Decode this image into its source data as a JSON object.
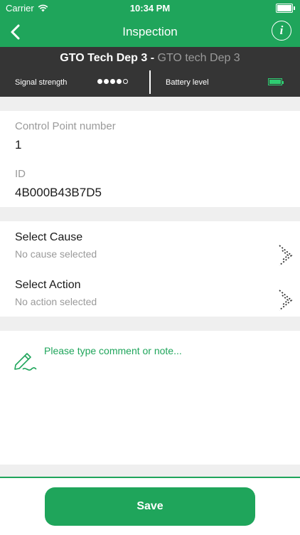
{
  "status_bar": {
    "carrier": "Carrier",
    "time": "10:34 PM"
  },
  "nav": {
    "title": "Inspection",
    "back_icon": "chevron-left-icon",
    "info_icon": "info-icon"
  },
  "device": {
    "name": "GTO Tech Dep 3",
    "separator": " - ",
    "subname": "GTO tech Dep 3",
    "signal_label": "Signal strength",
    "signal_level": 4,
    "signal_max": 5,
    "battery_label": "Battery level",
    "battery_level": 1.0,
    "battery_color": "#2ecc71"
  },
  "control_point": {
    "label": "Control Point number",
    "value": "1",
    "id_label": "ID",
    "id_value": "4B000B43B7D5"
  },
  "cause": {
    "title": "Select Cause",
    "subtitle": "No cause selected"
  },
  "action": {
    "title": "Select Action",
    "subtitle": "No action selected"
  },
  "comment": {
    "placeholder": "Please type comment or note...",
    "icon": "pencil-icon"
  },
  "save_label": "Save",
  "colors": {
    "accent": "#1fa55b",
    "header_dark": "#353535"
  }
}
